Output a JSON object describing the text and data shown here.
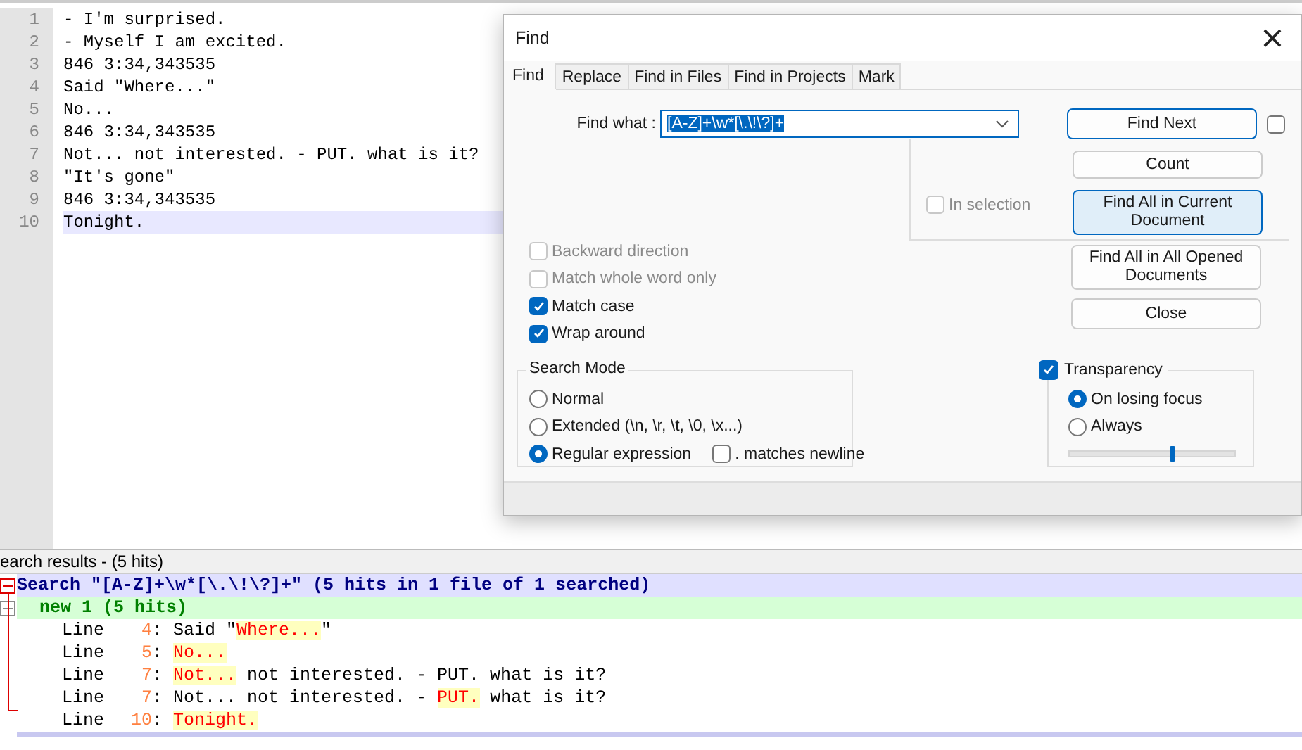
{
  "editor": {
    "lines": [
      {
        "number": "1",
        "text": "- I'm surprised.",
        "current": false
      },
      {
        "number": "2",
        "text": "- Myself I am excited.",
        "current": false
      },
      {
        "number": "3",
        "text": "846 3:34,343535",
        "current": false
      },
      {
        "number": "4",
        "text": "Said \"Where...\"",
        "current": false
      },
      {
        "number": "5",
        "text": "No...",
        "current": false
      },
      {
        "number": "6",
        "text": "846 3:34,343535",
        "current": false
      },
      {
        "number": "7",
        "text": "Not... not interested. - PUT. what is it?",
        "current": false
      },
      {
        "number": "8",
        "text": "\"It's gone\"",
        "current": false
      },
      {
        "number": "9",
        "text": "846 3:34,343535",
        "current": false
      },
      {
        "number": "10",
        "text": "Tonight.",
        "current": true
      }
    ]
  },
  "dialog": {
    "title": "Find",
    "close": "×",
    "tabs": [
      {
        "label": "Find",
        "selected": true
      },
      {
        "label": "Replace",
        "selected": false
      },
      {
        "label": "Find in Files",
        "selected": false
      },
      {
        "label": "Find in Projects",
        "selected": false
      },
      {
        "label": "Mark",
        "selected": false
      }
    ],
    "find_what": {
      "label": "Find what :",
      "value": "[A-Z]+\\w*[\\.\\!\\?]+"
    },
    "find_next_checkbox": {
      "checked": false
    },
    "in_selection": {
      "label": "In selection",
      "checked": false,
      "disabled": true
    },
    "buttons": [
      {
        "label": "Find Next",
        "focused": true,
        "hovered": false
      },
      {
        "label": "Count",
        "focused": false,
        "hovered": false
      },
      {
        "label": "Find All in Current Document",
        "focused": false,
        "hovered": true
      },
      {
        "label": "Find All in All Opened Documents",
        "focused": false,
        "hovered": false
      },
      {
        "label": "Close",
        "focused": false,
        "hovered": false
      }
    ],
    "options": [
      {
        "label": "Backward direction",
        "checked": false,
        "disabled": true
      },
      {
        "label": "Match whole word only",
        "checked": false,
        "disabled": true
      },
      {
        "label": "Match case",
        "checked": true,
        "disabled": false
      },
      {
        "label": "Wrap around",
        "checked": true,
        "disabled": false
      }
    ],
    "search_mode": {
      "title": "Search Mode",
      "modes": [
        {
          "label": "Normal",
          "selected": false
        },
        {
          "label": "Extended (\\n, \\r, \\t, \\0, \\x...)",
          "selected": false
        },
        {
          "label": "Regular expression",
          "selected": true
        }
      ],
      "matches_newline": {
        "label": ". matches newline",
        "checked": false
      }
    },
    "transparency": {
      "label": "Transparency",
      "checked": true,
      "modes": [
        {
          "label": "On losing focus",
          "selected": true
        },
        {
          "label": "Always",
          "selected": false
        }
      ],
      "level": 0.62
    }
  },
  "results": {
    "title": "earch results - (5 hits)",
    "search_line": "Search \"[A-Z]+\\w*[\\.\\!\\?]+\" (5 hits in 1 file of 1 searched)",
    "file_line": "new 1 (5 hits)",
    "hits": [
      {
        "prefix": "Line",
        "number": "4",
        "before": ": Said \"",
        "match": "Where...",
        "after": "\""
      },
      {
        "prefix": "Line",
        "number": "5",
        "before": ": ",
        "match": "No..."
      },
      {
        "prefix": "Line",
        "number": "7",
        "before": ": ",
        "match": "Not...",
        "after": " not interested. - PUT. what is it?"
      },
      {
        "prefix": "Line",
        "number": "7",
        "before": ": Not... not interested. - ",
        "match": "PUT.",
        "after": " what is it?"
      },
      {
        "prefix": "Line",
        "number": "10",
        "before": ": ",
        "match": "Tonight."
      }
    ]
  }
}
